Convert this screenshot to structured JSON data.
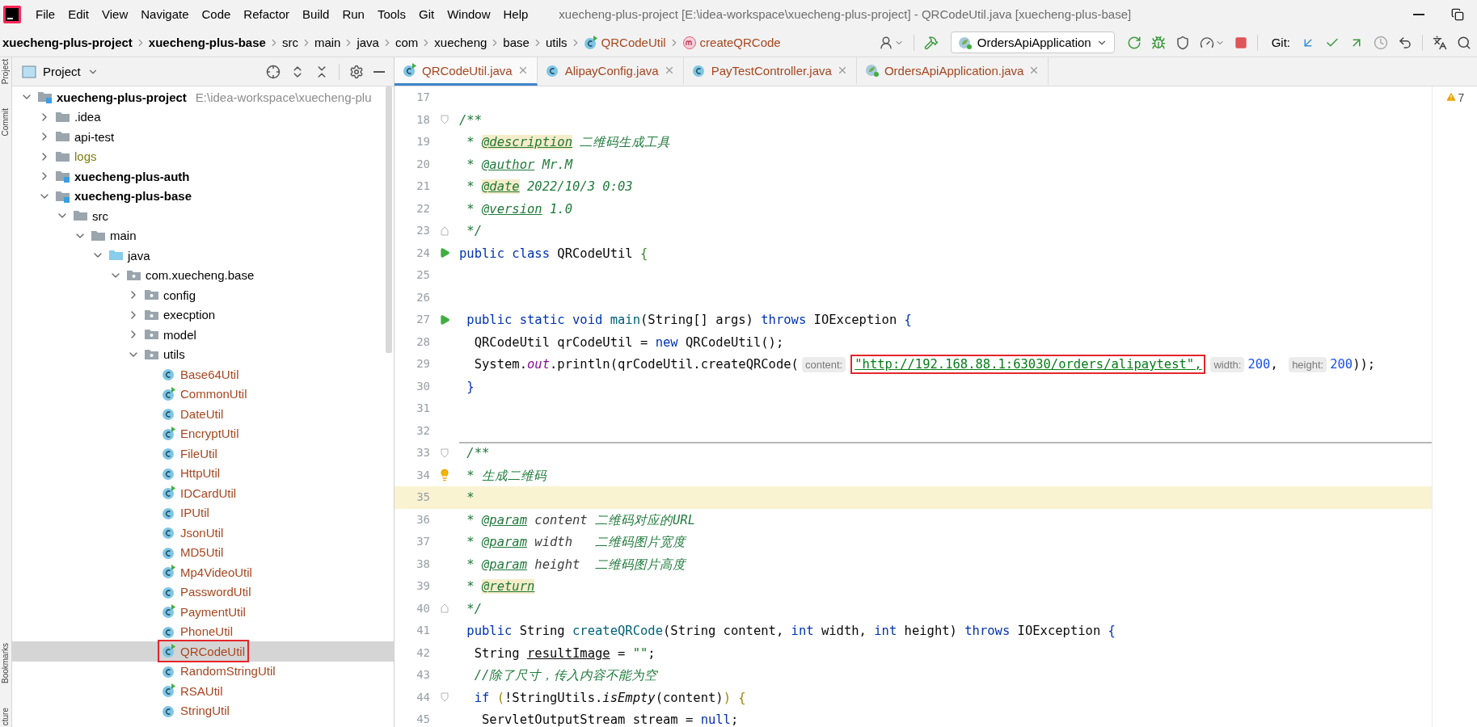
{
  "window": {
    "title": "xuecheng-plus-project [E:\\idea-workspace\\xuecheng-plus-project] - QRCodeUtil.java [xuecheng-plus-base]"
  },
  "menu": [
    "File",
    "Edit",
    "View",
    "Navigate",
    "Code",
    "Refactor",
    "Build",
    "Run",
    "Tools",
    "Git",
    "Window",
    "Help"
  ],
  "breadcrumbs": [
    {
      "kind": "module",
      "label": "xuecheng-plus-project"
    },
    {
      "kind": "module",
      "label": "xuecheng-plus-base"
    },
    {
      "kind": "dir",
      "label": "src"
    },
    {
      "kind": "dir",
      "label": "main"
    },
    {
      "kind": "dir",
      "label": "java"
    },
    {
      "kind": "dir",
      "label": "com"
    },
    {
      "kind": "dir",
      "label": "xuecheng"
    },
    {
      "kind": "dir",
      "label": "base"
    },
    {
      "kind": "dir",
      "label": "utils"
    },
    {
      "kind": "class",
      "label": "QRCodeUtil"
    },
    {
      "kind": "method",
      "label": "createQRCode"
    }
  ],
  "toolbar": {
    "run_config": "OrdersApiApplication",
    "git_label": "Git:"
  },
  "side_strip": [
    "Project",
    "Commit",
    "Bookmarks",
    "cture"
  ],
  "project_panel": {
    "title": "Project"
  },
  "project_tree": {
    "items": [
      {
        "kind": "module",
        "label": "xuecheng-plus-project",
        "hint": "E:\\idea-workspace\\xuecheng-plu",
        "expanded": true,
        "selected": false,
        "children": [
          {
            "kind": "folder",
            "label": ".idea",
            "expanded": false,
            "selected": false
          },
          {
            "kind": "folder",
            "label": "api-test",
            "expanded": false,
            "selected": false
          },
          {
            "kind": "excluded-folder",
            "label": "logs",
            "expanded": false,
            "selected": false
          },
          {
            "kind": "module",
            "label": "xuecheng-plus-auth",
            "expanded": false,
            "selected": false
          },
          {
            "kind": "module",
            "label": "xuecheng-plus-base",
            "expanded": true,
            "selected": false,
            "children": [
              {
                "kind": "folder",
                "label": "src",
                "expanded": true,
                "selected": false,
                "children": [
                  {
                    "kind": "folder",
                    "label": "main",
                    "expanded": true,
                    "selected": false,
                    "children": [
                      {
                        "kind": "source-folder",
                        "label": "java",
                        "expanded": true,
                        "selected": false,
                        "children": [
                          {
                            "kind": "package",
                            "label": "com.xuecheng.base",
                            "expanded": true,
                            "selected": false,
                            "children": [
                              {
                                "kind": "package",
                                "label": "config",
                                "expanded": false,
                                "selected": false
                              },
                              {
                                "kind": "package",
                                "label": "execption",
                                "expanded": false,
                                "selected": false
                              },
                              {
                                "kind": "package",
                                "label": "model",
                                "expanded": false,
                                "selected": false
                              },
                              {
                                "kind": "package",
                                "label": "utils",
                                "expanded": true,
                                "selected": false,
                                "children": [
                                  {
                                    "kind": "class",
                                    "label": "Base64Util",
                                    "selected": false
                                  },
                                  {
                                    "kind": "runnable-class",
                                    "label": "CommonUtil",
                                    "selected": false
                                  },
                                  {
                                    "kind": "class",
                                    "label": "DateUtil",
                                    "selected": false
                                  },
                                  {
                                    "kind": "runnable-class",
                                    "label": "EncryptUtil",
                                    "selected": false
                                  },
                                  {
                                    "kind": "class",
                                    "label": "FileUtil",
                                    "selected": false
                                  },
                                  {
                                    "kind": "class",
                                    "label": "HttpUtil",
                                    "selected": false
                                  },
                                  {
                                    "kind": "runnable-class",
                                    "label": "IDCardUtil",
                                    "selected": false
                                  },
                                  {
                                    "kind": "class",
                                    "label": "IPUtil",
                                    "selected": false
                                  },
                                  {
                                    "kind": "class",
                                    "label": "JsonUtil",
                                    "selected": false
                                  },
                                  {
                                    "kind": "class",
                                    "label": "MD5Util",
                                    "selected": false
                                  },
                                  {
                                    "kind": "runnable-class",
                                    "label": "Mp4VideoUtil",
                                    "selected": false
                                  },
                                  {
                                    "kind": "class",
                                    "label": "PasswordUtil",
                                    "selected": false
                                  },
                                  {
                                    "kind": "runnable-class",
                                    "label": "PaymentUtil",
                                    "selected": false
                                  },
                                  {
                                    "kind": "class",
                                    "label": "PhoneUtil",
                                    "selected": false
                                  },
                                  {
                                    "kind": "runnable-class",
                                    "label": "QRCodeUtil",
                                    "selected": true,
                                    "annotated": true
                                  },
                                  {
                                    "kind": "class",
                                    "label": "RandomStringUtil",
                                    "selected": false
                                  },
                                  {
                                    "kind": "runnable-class",
                                    "label": "RSAUtil",
                                    "selected": false
                                  },
                                  {
                                    "kind": "class",
                                    "label": "StringUtil",
                                    "selected": false
                                  }
                                ]
                              }
                            ]
                          }
                        ]
                      }
                    ]
                  }
                ]
              }
            ]
          }
        ]
      }
    ]
  },
  "editor": {
    "tabs": [
      {
        "kind": "runnable-class",
        "label": "QRCodeUtil.java",
        "selected": true
      },
      {
        "kind": "class",
        "label": "AlipayConfig.java",
        "selected": false
      },
      {
        "kind": "class",
        "label": "PayTestController.java",
        "selected": false
      },
      {
        "kind": "spring-app",
        "label": "OrdersApiApplication.java",
        "selected": false
      }
    ],
    "warnings": "7",
    "lines": [
      {
        "number": "17",
        "current": false,
        "separator": false
      },
      {
        "number": "18",
        "current": false,
        "separator": false,
        "gutter": {
          "kind": "fold-start"
        },
        "tokens": [
          {
            "kind": "doc",
            "text": "/**"
          }
        ]
      },
      {
        "number": "19",
        "current": false,
        "separator": false,
        "tokens": [
          {
            "kind": "doc",
            "text": " * "
          },
          {
            "kind": "doctag-marked",
            "text": "@description"
          },
          {
            "kind": "doc",
            "text": " 二维码生成工具"
          }
        ]
      },
      {
        "number": "20",
        "current": false,
        "separator": false,
        "tokens": [
          {
            "kind": "doc",
            "text": " * "
          },
          {
            "kind": "doctag",
            "text": "@author"
          },
          {
            "kind": "doc",
            "text": " Mr.M"
          }
        ]
      },
      {
        "number": "21",
        "current": false,
        "separator": false,
        "tokens": [
          {
            "kind": "doc",
            "text": " * "
          },
          {
            "kind": "doctag-marked",
            "text": "@date"
          },
          {
            "kind": "doc",
            "text": " 2022/10/3 0:03"
          }
        ]
      },
      {
        "number": "22",
        "current": false,
        "separator": false,
        "tokens": [
          {
            "kind": "doc",
            "text": " * "
          },
          {
            "kind": "doctag",
            "text": "@version"
          },
          {
            "kind": "doc",
            "text": " 1.0"
          }
        ]
      },
      {
        "number": "23",
        "current": false,
        "separator": false,
        "gutter": {
          "kind": "fold-end"
        },
        "tokens": [
          {
            "kind": "doc",
            "text": " */"
          }
        ]
      },
      {
        "number": "24",
        "current": false,
        "separator": false,
        "gutter": {
          "kind": "run"
        },
        "tokens": [
          {
            "kind": "keyword",
            "text": "public class "
          },
          {
            "kind": "plain",
            "text": "QRCodeUtil "
          },
          {
            "kind": "bracket-green",
            "text": "{"
          }
        ]
      },
      {
        "number": "25",
        "current": false,
        "separator": false
      },
      {
        "number": "26",
        "current": false,
        "separator": false
      },
      {
        "number": "27",
        "current": false,
        "separator": false,
        "gutter": {
          "kind": "run"
        },
        "tokens": [
          {
            "kind": "keyword",
            "text": " public static void "
          },
          {
            "kind": "method-decl",
            "text": "main"
          },
          {
            "kind": "plain",
            "text": "(String[] args) "
          },
          {
            "kind": "keyword",
            "text": "throws "
          },
          {
            "kind": "plain",
            "text": "IOException "
          },
          {
            "kind": "bracket-blue",
            "text": "{"
          }
        ]
      },
      {
        "number": "28",
        "current": false,
        "separator": false,
        "tokens": [
          {
            "kind": "plain",
            "text": "  QRCodeUtil qrCodeUtil = "
          },
          {
            "kind": "keyword",
            "text": "new "
          },
          {
            "kind": "plain",
            "text": "QRCodeUtil();"
          }
        ]
      },
      {
        "number": "29",
        "current": false,
        "separator": false,
        "tokens": [
          {
            "kind": "plain",
            "text": "  System."
          },
          {
            "kind": "static-field",
            "text": "out"
          },
          {
            "kind": "plain",
            "text": ".println(qrCodeUtil.createQRCode("
          },
          {
            "kind": "hint",
            "text": "content:"
          },
          {
            "kind": "link-string",
            "text": "\"http://192.168.88.1:63030/orders/alipaytest\",",
            "annotated": true
          },
          {
            "kind": "hint",
            "text": "width:"
          },
          {
            "kind": "number",
            "text": "200"
          },
          {
            "kind": "plain",
            "text": ", "
          },
          {
            "kind": "hint",
            "text": "height:"
          },
          {
            "kind": "number",
            "text": "200"
          },
          {
            "kind": "plain",
            "text": "));"
          }
        ]
      },
      {
        "number": "30",
        "current": false,
        "separator": false,
        "tokens": [
          {
            "kind": "bracket-blue",
            "text": " }"
          }
        ]
      },
      {
        "number": "31",
        "current": false,
        "separator": false
      },
      {
        "number": "32",
        "current": false,
        "separator": false
      },
      {
        "number": "33",
        "current": false,
        "separator": true,
        "gutter": {
          "kind": "fold-start"
        },
        "tokens": [
          {
            "kind": "doc",
            "text": " /**"
          }
        ]
      },
      {
        "number": "34",
        "current": false,
        "separator": false,
        "gutter": {
          "kind": "bulb"
        },
        "tokens": [
          {
            "kind": "doc",
            "text": " * 生成二维码"
          }
        ]
      },
      {
        "number": "35",
        "current": true,
        "separator": false,
        "tokens": [
          {
            "kind": "doc",
            "text": " *"
          }
        ]
      },
      {
        "number": "36",
        "current": false,
        "separator": false,
        "tokens": [
          {
            "kind": "doc",
            "text": " * "
          },
          {
            "kind": "doctag",
            "text": "@param"
          },
          {
            "kind": "docparam",
            "text": " content"
          },
          {
            "kind": "doc",
            "text": " 二维码对应的URL"
          }
        ]
      },
      {
        "number": "37",
        "current": false,
        "separator": false,
        "tokens": [
          {
            "kind": "doc",
            "text": " * "
          },
          {
            "kind": "doctag",
            "text": "@param"
          },
          {
            "kind": "docparam",
            "text": " width"
          },
          {
            "kind": "doc",
            "text": "   二维码图片宽度"
          }
        ]
      },
      {
        "number": "38",
        "current": false,
        "separator": false,
        "tokens": [
          {
            "kind": "doc",
            "text": " * "
          },
          {
            "kind": "doctag",
            "text": "@param"
          },
          {
            "kind": "docparam",
            "text": " height"
          },
          {
            "kind": "doc",
            "text": "  二维码图片高度"
          }
        ]
      },
      {
        "number": "39",
        "current": false,
        "separator": false,
        "tokens": [
          {
            "kind": "doc",
            "text": " * "
          },
          {
            "kind": "doctag-marked",
            "text": "@return"
          }
        ]
      },
      {
        "number": "40",
        "current": false,
        "separator": false,
        "gutter": {
          "kind": "fold-end"
        },
        "tokens": [
          {
            "kind": "doc",
            "text": " */"
          }
        ]
      },
      {
        "number": "41",
        "current": false,
        "separator": false,
        "tokens": [
          {
            "kind": "keyword",
            "text": " public "
          },
          {
            "kind": "plain",
            "text": "String "
          },
          {
            "kind": "method-decl",
            "text": "createQRCode"
          },
          {
            "kind": "plain",
            "text": "(String content, "
          },
          {
            "kind": "keyword",
            "text": "int "
          },
          {
            "kind": "plain",
            "text": "width, "
          },
          {
            "kind": "keyword",
            "text": "int "
          },
          {
            "kind": "plain",
            "text": "height) "
          },
          {
            "kind": "keyword",
            "text": "throws "
          },
          {
            "kind": "plain",
            "text": "IOException "
          },
          {
            "kind": "bracket-blue",
            "text": "{"
          }
        ]
      },
      {
        "number": "42",
        "current": false,
        "separator": false,
        "tokens": [
          {
            "kind": "plain",
            "text": "  String "
          },
          {
            "kind": "underlined",
            "text": "resultImage"
          },
          {
            "kind": "plain",
            "text": " = "
          },
          {
            "kind": "string",
            "text": "\"\""
          },
          {
            "kind": "plain",
            "text": ";"
          }
        ]
      },
      {
        "number": "43",
        "current": false,
        "separator": false,
        "tokens": [
          {
            "kind": "comment",
            "text": "  //除了尺寸，传入内容不能为空"
          }
        ]
      },
      {
        "number": "44",
        "current": false,
        "separator": false,
        "gutter": {
          "kind": "fold-start"
        },
        "tokens": [
          {
            "kind": "keyword",
            "text": "  if "
          },
          {
            "kind": "bracket-gold",
            "text": "("
          },
          {
            "kind": "plain",
            "text": "!StringUtils."
          },
          {
            "kind": "static-call",
            "text": "isEmpty"
          },
          {
            "kind": "plain",
            "text": "(content)"
          },
          {
            "kind": "bracket-gold",
            "text": ")"
          },
          {
            "kind": "bracket-gold",
            "text": " {"
          }
        ]
      },
      {
        "number": "45",
        "current": false,
        "separator": false,
        "tokens": [
          {
            "kind": "plain",
            "text": "   ServletOutputStream stream = "
          },
          {
            "kind": "keyword",
            "text": "null"
          },
          {
            "kind": "plain",
            "text": ";"
          }
        ]
      }
    ]
  }
}
